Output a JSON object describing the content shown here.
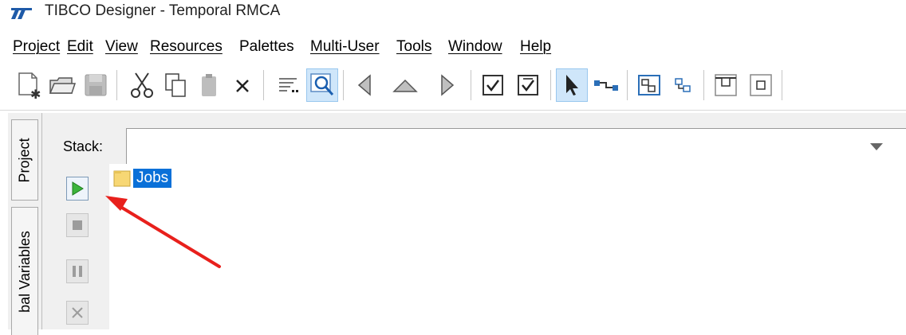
{
  "window": {
    "title": "TIBCO Designer - Temporal RMCA"
  },
  "menubar": {
    "items": [
      {
        "label": "Project"
      },
      {
        "label": "Edit"
      },
      {
        "label": "View"
      },
      {
        "label": "Resources"
      },
      {
        "label": "Palettes"
      },
      {
        "label": "Multi-User"
      },
      {
        "label": "Tools"
      },
      {
        "label": "Window"
      },
      {
        "label": "Help"
      }
    ]
  },
  "toolbar": {
    "buttons": [
      {
        "icon": "new-project-icon"
      },
      {
        "icon": "open-folder-icon"
      },
      {
        "icon": "save-icon"
      },
      {
        "icon": "cut-icon"
      },
      {
        "icon": "copy-icon"
      },
      {
        "icon": "paste-icon"
      },
      {
        "icon": "delete-icon"
      },
      {
        "icon": "filter-icon"
      },
      {
        "icon": "find-icon"
      },
      {
        "icon": "back-icon"
      },
      {
        "icon": "up-icon"
      },
      {
        "icon": "forward-icon"
      },
      {
        "icon": "checkin-icon"
      },
      {
        "icon": "checkout-icon"
      },
      {
        "icon": "select-pointer-icon"
      },
      {
        "icon": "connect-transition-icon"
      },
      {
        "icon": "group-icon"
      },
      {
        "icon": "ungroup-icon"
      },
      {
        "icon": "align-top-icon"
      },
      {
        "icon": "align-middle-icon"
      }
    ]
  },
  "left_tabs": {
    "project": "Project",
    "global_variables": "bal Variables"
  },
  "stack": {
    "label": "Stack:",
    "value": ""
  },
  "tree": {
    "items": [
      {
        "label": "Jobs",
        "selected": true
      }
    ]
  },
  "colors": {
    "selection": "#0a70d8",
    "annotation_arrow": "#e8201c",
    "run_green": "#3cb43c"
  }
}
